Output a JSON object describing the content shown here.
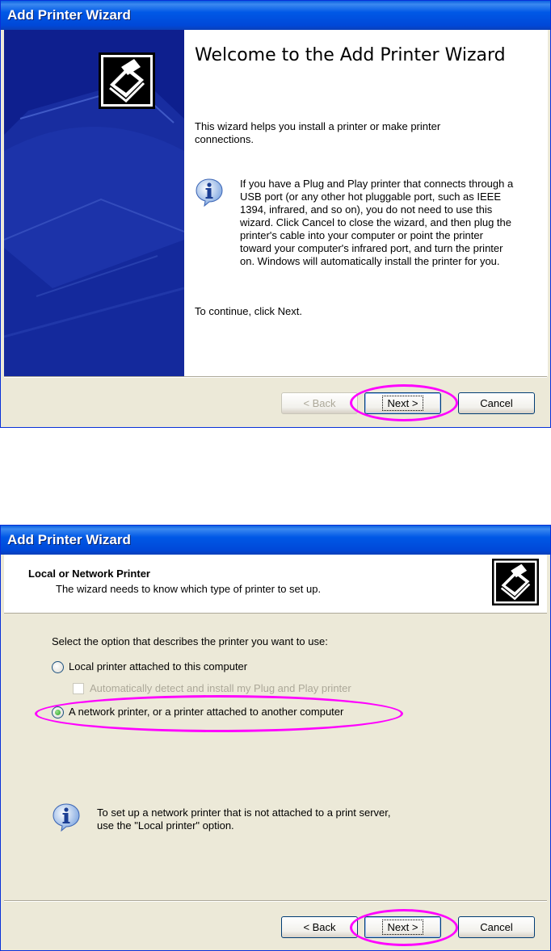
{
  "dialog1": {
    "title": "Add Printer Wizard",
    "welcome_title": "Welcome to the Add Printer Wizard",
    "intro": "This wizard helps you install a printer or make printer connections.",
    "info_text": "If you have a Plug and Play printer that connects through a USB port (or any other hot pluggable port, such as IEEE 1394, infrared, and so on), you do not need to use this wizard. Click Cancel to close the wizard, and then plug the printer's cable into your computer or point the printer toward your computer's infrared port, and turn the printer on. Windows will automatically install the printer for you.",
    "continue_text": "To continue, click Next.",
    "buttons": {
      "back": "< Back",
      "next": "Next >",
      "cancel": "Cancel"
    },
    "back_enabled": false
  },
  "dialog2": {
    "title": "Add Printer Wizard",
    "header_title": "Local or Network Printer",
    "header_subtitle": "The wizard needs to know which type of printer to set up.",
    "prompt": "Select the option that describes the printer you want to use:",
    "options": {
      "local": "Local printer attached to this computer",
      "auto_detect": "Automatically detect and install my Plug and Play printer",
      "network": "A network printer, or a printer attached to another computer"
    },
    "selected_option": "network",
    "info_text_line1": "To set up a network printer that is not attached to a print server,",
    "info_text_line2": "use the \"Local printer\" option.",
    "buttons": {
      "back": "< Back",
      "next": "Next >",
      "cancel": "Cancel"
    }
  },
  "colors": {
    "titlebar": "#0058e6",
    "dialog_bg": "#ece9d8",
    "sidebar": "#0e1f8e",
    "highlight": "#ff00ff"
  },
  "icons": [
    "printer-icon",
    "info-icon",
    "radio-button",
    "checkbox"
  ]
}
